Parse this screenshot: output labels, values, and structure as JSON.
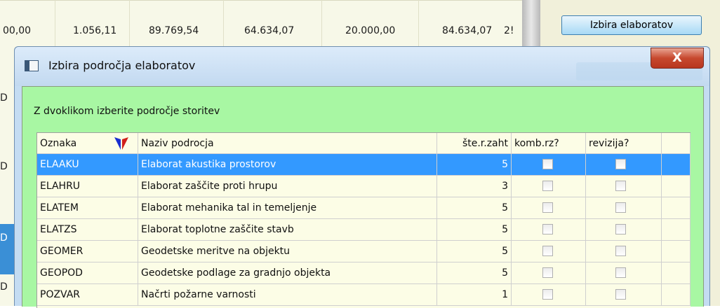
{
  "background": {
    "values": [
      "00,00",
      "1.056,11",
      "89.769,54",
      "64.634,07",
      "20.000,00",
      "84.634,07",
      "2!"
    ],
    "button_label": "Izbira elaboratov",
    "left_glyphs": [
      "D",
      "D",
      "D",
      "D",
      "D"
    ]
  },
  "dialog": {
    "title": "Izbira področja elaboratov",
    "close_label": "X",
    "instruction": "Z dvoklikom izberite področje storitev"
  },
  "grid": {
    "columns": [
      "Oznaka",
      "Naziv podrocja",
      "šte.r.zaht",
      "komb.rz?",
      "revizija?"
    ],
    "rows": [
      {
        "code": "ELAAKU",
        "name": "Elaborat akustika prostorov",
        "count": "5",
        "komb": false,
        "rev": false
      },
      {
        "code": "ELAHRU",
        "name": "Elaborat zaščite proti hrupu",
        "count": "3",
        "komb": false,
        "rev": false
      },
      {
        "code": "ELATEM",
        "name": "Elaborat mehanika tal in temeljenje",
        "count": "5",
        "komb": false,
        "rev": false
      },
      {
        "code": "ELATZS",
        "name": "Elaborat toplotne zaščite stavb",
        "count": "5",
        "komb": false,
        "rev": false
      },
      {
        "code": "GEOMER",
        "name": "Geodetske meritve na objektu",
        "count": "5",
        "komb": false,
        "rev": false
      },
      {
        "code": "GEOPOD",
        "name": "Geodetske podlage za gradnjo objekta",
        "count": "5",
        "komb": false,
        "rev": false
      },
      {
        "code": "POZVAR",
        "name": "Načrti požarne varnosti",
        "count": "1",
        "komb": false,
        "rev": false
      }
    ],
    "selected_row": 0,
    "colors": {
      "selection": "#3399ff",
      "content_bg": "#a8f7a3",
      "grid_bg": "#fcfde6"
    }
  }
}
